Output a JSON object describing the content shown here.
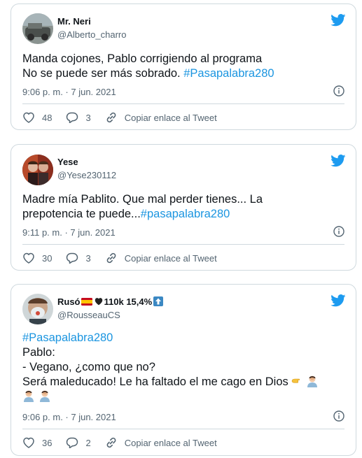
{
  "tweets": [
    {
      "name": "Mr. Neri",
      "handle": "@Alberto_charro",
      "lines": [
        "Manda cojones, Pablo corrigiendo al programa",
        "No se puede ser más sobrado. "
      ],
      "hashtag": "#Pasapalabra280",
      "timestamp": "9:06 p. m. · 7 jun. 2021",
      "likes": "48",
      "replies": "3",
      "copy_label": "Copiar enlace al Tweet"
    },
    {
      "name": "Yese",
      "handle": "@Yese230112",
      "lines": [
        "Madre mía Pablito. Que mal perder tienes... La",
        "prepotencia te puede..."
      ],
      "hashtag": "#pasapalabra280",
      "timestamp": "9:11 p. m. · 7 jun. 2021",
      "likes": "30",
      "replies": "3",
      "copy_label": "Copiar enlace al Tweet"
    },
    {
      "name_prefix": "Rusó",
      "name_suffix": "110k 15,4%",
      "handle": "@RousseauCS",
      "hashtag": "#Pasapalabra280",
      "lines": [
        "Pablo:",
        "- Vegano, ¿como que no?",
        "Será maleducado! Le ha faltado el me cago en Dios "
      ],
      "timestamp": "9:06 p. m. · 7 jun. 2021",
      "likes": "36",
      "replies": "2",
      "copy_label": "Copiar enlace al Tweet"
    }
  ],
  "colors": {
    "accent": "#1b95e0",
    "twitter_blue": "#1d9bf0",
    "text": "#0f1419",
    "secondary": "#536471",
    "border": "#cfd9de"
  },
  "icons": {
    "bird": "twitter-bird-icon",
    "info": "info-icon",
    "like": "heart-icon",
    "reply": "reply-bubble-icon",
    "copy": "link-icon"
  }
}
